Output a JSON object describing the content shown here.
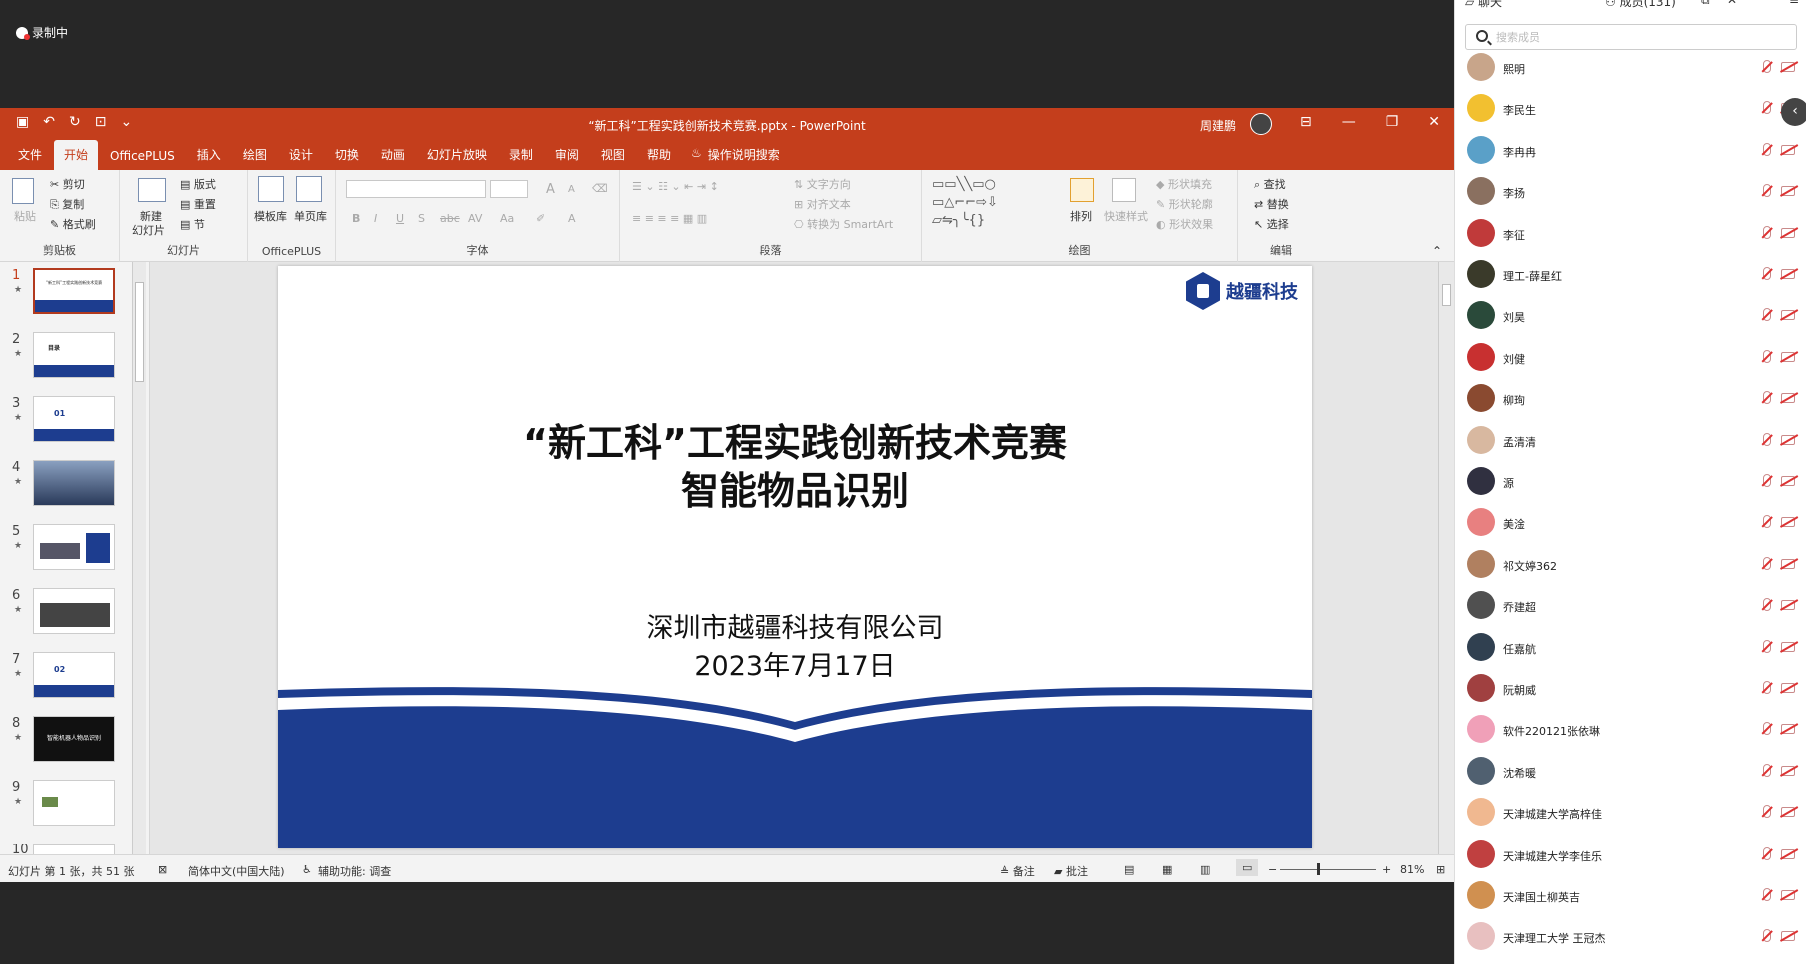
{
  "recording": {
    "label": "录制中"
  },
  "window": {
    "title": "“新工科”工程实践创新技术竞赛.pptx  -  PowerPoint",
    "user": "周建鹏",
    "controls": [
      "⊟",
      "—",
      "❐",
      "✕"
    ]
  },
  "tabs": [
    "文件",
    "开始",
    "OfficePLUS",
    "插入",
    "绘图",
    "设计",
    "切换",
    "动画",
    "幻灯片放映",
    "录制",
    "审阅",
    "视图",
    "帮助"
  ],
  "active_tab": "开始",
  "tell_me": "操作说明搜索",
  "ribbon": {
    "clipboard": {
      "paste": "粘贴",
      "cut": "剪切",
      "copy": "复制",
      "format_painter": "格式刷",
      "label": "剪贴板"
    },
    "slides": {
      "new_slide_line1": "新建",
      "new_slide_line2": "幻灯片",
      "layout": "版式",
      "reset": "重置",
      "section": "节",
      "label": "幻灯片"
    },
    "officeplus": {
      "template": "模板库",
      "single_page": "单页库",
      "label": "OfficePLUS"
    },
    "font": {
      "label": "字体",
      "bold": "B",
      "italic": "I",
      "underline": "U",
      "shadow": "S",
      "strike": "abc",
      "spacing": "AV",
      "case": "Aa",
      "size_up": "A",
      "size_down": "A"
    },
    "paragraph": {
      "text_direction": "文字方向",
      "align_text": "对齐文本",
      "smartart": "转换为 SmartArt",
      "label": "段落"
    },
    "drawing": {
      "arrange": "排列",
      "quick_styles": "快速样式",
      "fill": "形状填充",
      "outline": "形状轮廓",
      "effect": "形状效果",
      "label": "绘图"
    },
    "editing": {
      "find": "查找",
      "replace": "替换",
      "select": "选择",
      "label": "编辑"
    }
  },
  "thumbnails": [
    {
      "num": "1",
      "text": "“新工科”工程实践创新技术竞赛"
    },
    {
      "num": "2",
      "text": "目录"
    },
    {
      "num": "3",
      "text": "01"
    },
    {
      "num": "4",
      "text": ""
    },
    {
      "num": "5",
      "text": ""
    },
    {
      "num": "6",
      "text": ""
    },
    {
      "num": "7",
      "text": "02"
    },
    {
      "num": "8",
      "text": "智能机器人物品识别"
    },
    {
      "num": "9",
      "text": ""
    },
    {
      "num": "10",
      "text": ""
    }
  ],
  "slide": {
    "logo_text": "越疆科技",
    "title_line1": "“新工科”工程实践创新技术竞赛",
    "title_line2": "智能物品识别",
    "company": "深圳市越疆科技有限公司",
    "date": "2023年7月17日"
  },
  "status": {
    "slide_info": "幻灯片 第 1 张，共 51 张",
    "language": "简体中文(中国大陆)",
    "accessibility": "辅助功能: 调查",
    "notes": "备注",
    "comments": "批注",
    "zoom": "81%"
  },
  "panel": {
    "chat_tab": "聊天",
    "members_tab": "成员(131)",
    "search_placeholder": "搜索成员",
    "members": [
      {
        "name": "熙明",
        "color": "#c8a58a"
      },
      {
        "name": "李民生",
        "color": "#f2c030"
      },
      {
        "name": "李冉冉",
        "color": "#5aa0c8"
      },
      {
        "name": "李扬",
        "color": "#8a7060"
      },
      {
        "name": "李征",
        "color": "#c03a3a"
      },
      {
        "name": "理工-薛星红",
        "color": "#3a3a2a"
      },
      {
        "name": "刘昊",
        "color": "#2a4a3a"
      },
      {
        "name": "刘健",
        "color": "#c83030"
      },
      {
        "name": "柳珣",
        "color": "#8a4a30"
      },
      {
        "name": "孟清清",
        "color": "#d8b8a0"
      },
      {
        "name": "源",
        "color": "#303040"
      },
      {
        "name": "美淦",
        "color": "#e88080"
      },
      {
        "name": "祁文婷362",
        "color": "#b08060"
      },
      {
        "name": "乔建超",
        "color": "#505050"
      },
      {
        "name": "任嘉航",
        "color": "#304050"
      },
      {
        "name": "阮朝威",
        "color": "#a04040"
      },
      {
        "name": "软件220121张依琳",
        "color": "#f0a0b8"
      },
      {
        "name": "沈希暖",
        "color": "#506070"
      },
      {
        "name": "天津城建大学高梓佳",
        "color": "#f0b890"
      },
      {
        "name": "天津城建大学李佳乐",
        "color": "#c04040"
      },
      {
        "name": "天津国土柳英吉",
        "color": "#d09050"
      },
      {
        "name": "天津理工大学 王冠杰",
        "color": "#e8c0c0"
      }
    ]
  }
}
